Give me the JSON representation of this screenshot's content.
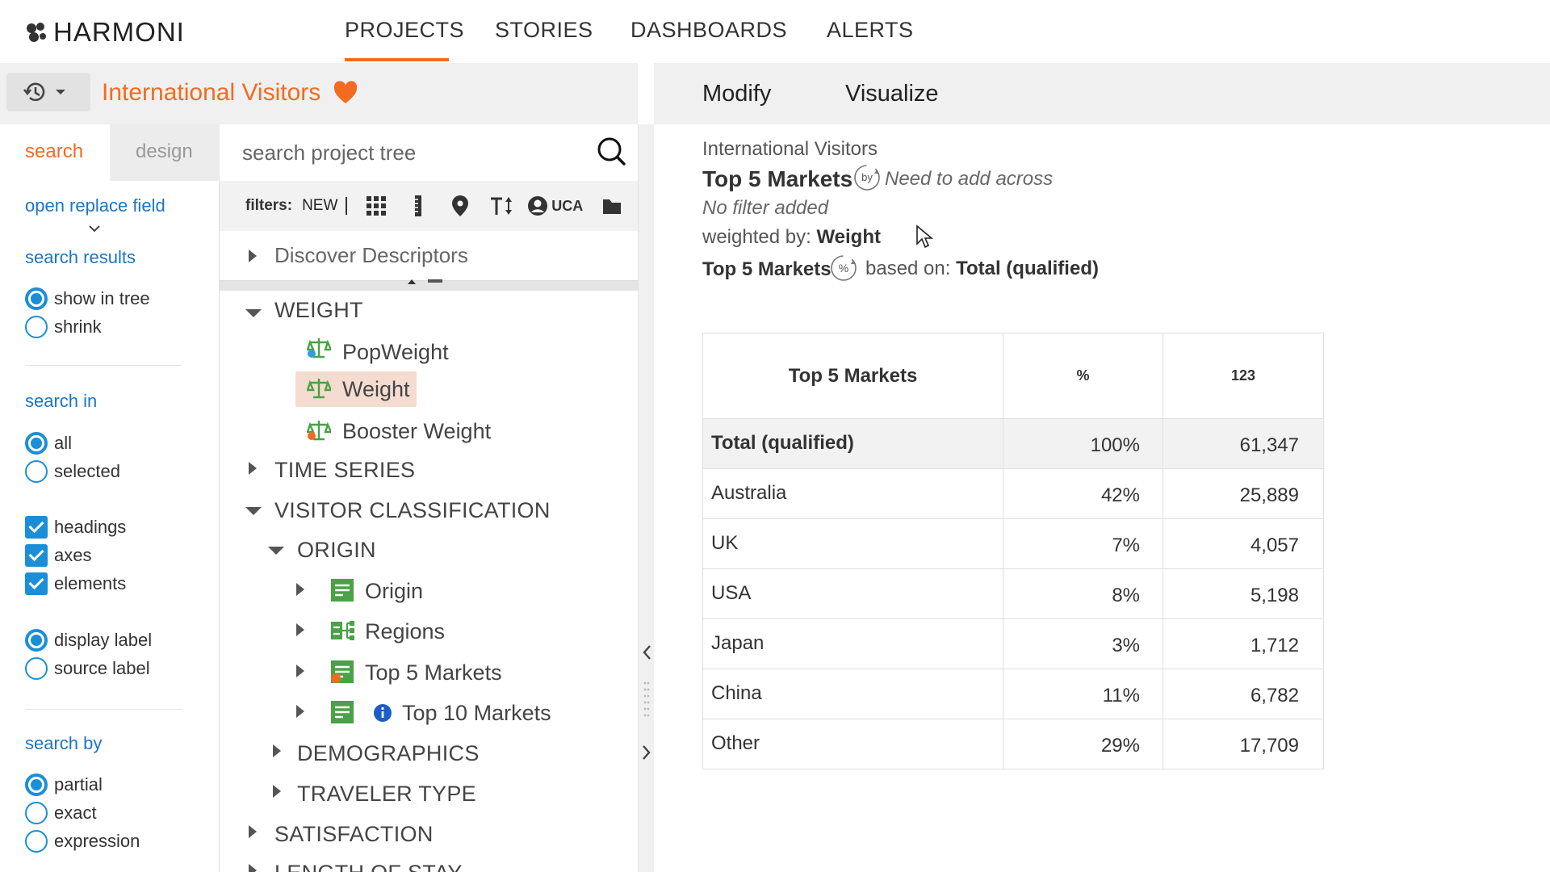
{
  "brand": {
    "name": "HARMONI",
    "accent": "#f26b21",
    "link": "#1d74c6",
    "control": "#1a8fd8"
  },
  "nav": {
    "tabs": [
      "PROJECTS",
      "STORIES",
      "DASHBOARDS",
      "ALERTS"
    ],
    "active": "PROJECTS"
  },
  "project": {
    "title": "International Visitors",
    "favorite_icon": "heart-icon",
    "history_icon": "history-icon"
  },
  "right_tabs": {
    "modify": "Modify",
    "visualize": "Visualize"
  },
  "left_panel": {
    "tabs": {
      "search": "search",
      "design": "design"
    },
    "open_replace": "open replace field",
    "search_results": {
      "heading": "search results",
      "options": [
        {
          "label": "show in tree",
          "selected": true
        },
        {
          "label": "shrink",
          "selected": false
        }
      ]
    },
    "search_in": {
      "heading": "search in",
      "options": [
        {
          "label": "all",
          "selected": true
        },
        {
          "label": "selected",
          "selected": false
        }
      ]
    },
    "checks": [
      {
        "label": "headings",
        "checked": true
      },
      {
        "label": "axes",
        "checked": true
      },
      {
        "label": "elements",
        "checked": true
      }
    ],
    "label_mode": {
      "options": [
        {
          "label": "display label",
          "selected": true
        },
        {
          "label": "source label",
          "selected": false
        }
      ]
    },
    "search_by": {
      "heading": "search by",
      "options": [
        {
          "label": "partial",
          "selected": true
        },
        {
          "label": "exact",
          "selected": false
        },
        {
          "label": "expression",
          "selected": false
        }
      ]
    }
  },
  "tree": {
    "search_placeholder": "search project tree",
    "filters_label": "filters:",
    "filter_new": "NEW",
    "filter_uca": "UCA",
    "filter_icons": [
      "grid-icon",
      "ruler-icon",
      "pin-icon",
      "text-size-icon",
      "user-icon",
      "folder-icon"
    ],
    "discover": "Discover Descriptors",
    "items": [
      {
        "label": "WEIGHT",
        "kind": "group",
        "expanded": true
      },
      {
        "label": "PopWeight",
        "kind": "weight"
      },
      {
        "label": "Weight",
        "kind": "weight",
        "selected": true
      },
      {
        "label": "Booster Weight",
        "kind": "weight"
      },
      {
        "label": "TIME SERIES",
        "kind": "group",
        "expanded": false
      },
      {
        "label": "VISITOR CLASSIFICATION",
        "kind": "group",
        "expanded": true
      },
      {
        "label": "ORIGIN",
        "kind": "group",
        "expanded": true
      },
      {
        "label": "Origin",
        "kind": "variable"
      },
      {
        "label": "Regions",
        "kind": "hierarchy"
      },
      {
        "label": "Top 5 Markets",
        "kind": "variable"
      },
      {
        "label": "Top 10 Markets",
        "kind": "variable",
        "info": true
      },
      {
        "label": "DEMOGRAPHICS",
        "kind": "group",
        "expanded": false
      },
      {
        "label": "TRAVELER TYPE",
        "kind": "group",
        "expanded": false
      },
      {
        "label": "SATISFACTION",
        "kind": "group",
        "expanded": false
      },
      {
        "label": "LENGTH OF STAY",
        "kind": "group",
        "expanded": false
      }
    ]
  },
  "report": {
    "project": "International Visitors",
    "title": "Top 5 Markets",
    "by_badge": "by",
    "across_hint": "Need to add across",
    "filter_text": "No filter added",
    "weighted_prefix": "weighted by:",
    "weighted_value": "Weight",
    "base_var": "Top 5 Markets",
    "pct_badge": "%",
    "based_prefix": "based on:",
    "based_value": "Total (qualified)",
    "table": {
      "headers": [
        "Top 5 Markets",
        "%",
        "123"
      ],
      "rows": [
        {
          "label": "Total (qualified)",
          "pct": "100%",
          "count": "61,347",
          "total": true
        },
        {
          "label": "Australia",
          "pct": "42%",
          "count": "25,889"
        },
        {
          "label": "UK",
          "pct": "7%",
          "count": "4,057"
        },
        {
          "label": "USA",
          "pct": "8%",
          "count": "5,198"
        },
        {
          "label": "Japan",
          "pct": "3%",
          "count": "1,712"
        },
        {
          "label": "China",
          "pct": "11%",
          "count": "6,782"
        },
        {
          "label": "Other",
          "pct": "29%",
          "count": "17,709"
        }
      ]
    }
  }
}
